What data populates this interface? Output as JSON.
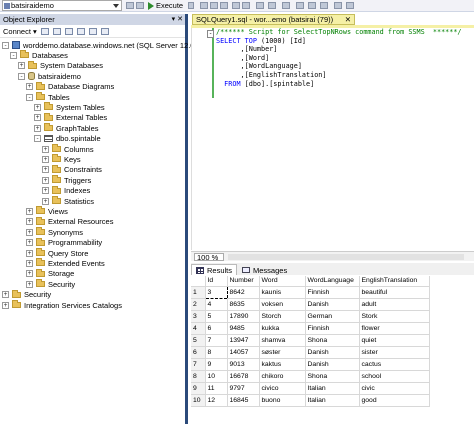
{
  "toolbar": {
    "database_dropdown": "batsiraidemo",
    "execute_label": "Execute"
  },
  "object_explorer": {
    "title": "Object Explorer",
    "connect_label": "Connect ▾",
    "tree": [
      {
        "label": "worddemo.database.windows.net (SQL Server 12.0",
        "exp": "-"
      },
      {
        "label": "Databases",
        "exp": "-"
      },
      {
        "label": "System Databases",
        "exp": "+"
      },
      {
        "label": "batsiraidemo",
        "exp": "-"
      },
      {
        "label": "Database Diagrams",
        "exp": "+"
      },
      {
        "label": "Tables",
        "exp": "-"
      },
      {
        "label": "System Tables",
        "exp": "+"
      },
      {
        "label": "External Tables",
        "exp": "+"
      },
      {
        "label": "GraphTables",
        "exp": "+"
      },
      {
        "label": "dbo.spintable",
        "exp": "-"
      },
      {
        "label": "Columns",
        "exp": "+"
      },
      {
        "label": "Keys",
        "exp": "+"
      },
      {
        "label": "Constraints",
        "exp": "+"
      },
      {
        "label": "Triggers",
        "exp": "+"
      },
      {
        "label": "Indexes",
        "exp": "+"
      },
      {
        "label": "Statistics",
        "exp": "+"
      },
      {
        "label": "Views",
        "exp": "+"
      },
      {
        "label": "External Resources",
        "exp": "+"
      },
      {
        "label": "Synonyms",
        "exp": "+"
      },
      {
        "label": "Programmability",
        "exp": "+"
      },
      {
        "label": "Query Store",
        "exp": "+"
      },
      {
        "label": "Extended Events",
        "exp": "+"
      },
      {
        "label": "Storage",
        "exp": "+"
      },
      {
        "label": "Security",
        "exp": "+"
      },
      {
        "label": "Security",
        "exp": "+"
      },
      {
        "label": "Integration Services Catalogs",
        "exp": "+"
      }
    ]
  },
  "query_tab": {
    "label": "SQLQuery1.sql - wor...emo (batsirai (79))",
    "close": "✕"
  },
  "editor": {
    "comment": "/****** Script for SelectTopNRows command from SSMS  ******/",
    "line_select_kw": "SELECT TOP",
    "line_select_rest": " (1000) [Id]",
    "line_number": "      ,[Number]",
    "line_word": "      ,[Word]",
    "line_wordlang": "      ,[WordLanguage]",
    "line_english": "      ,[EnglishTranslation]",
    "line_from_kw": "  FROM",
    "line_from_rest": " [dbo].[spintable]"
  },
  "zoom": "100 %",
  "results_tabs": {
    "results": "Results",
    "messages": "Messages"
  },
  "results": {
    "columns": [
      "Id",
      "Number",
      "Word",
      "WordLanguage",
      "EnglishTranslation"
    ],
    "rows": [
      [
        "1",
        "3",
        "8642",
        "kaunis",
        "Finnish",
        "beautiful"
      ],
      [
        "2",
        "4",
        "8635",
        "voksen",
        "Danish",
        "adult"
      ],
      [
        "3",
        "5",
        "17890",
        "Storch",
        "German",
        "Stork"
      ],
      [
        "4",
        "6",
        "9485",
        "kukka",
        "Finnish",
        "flower"
      ],
      [
        "5",
        "7",
        "13947",
        "shamva",
        "Shona",
        "quiet"
      ],
      [
        "6",
        "8",
        "14057",
        "søster",
        "Danish",
        "sister"
      ],
      [
        "7",
        "9",
        "9013",
        "kaktus",
        "Danish",
        "cactus"
      ],
      [
        "8",
        "10",
        "16678",
        "chikoro",
        "Shona",
        "school"
      ],
      [
        "9",
        "11",
        "9797",
        "civico",
        "Italian",
        "civic"
      ],
      [
        "10",
        "12",
        "16845",
        "buono",
        "Italian",
        "good"
      ]
    ]
  }
}
